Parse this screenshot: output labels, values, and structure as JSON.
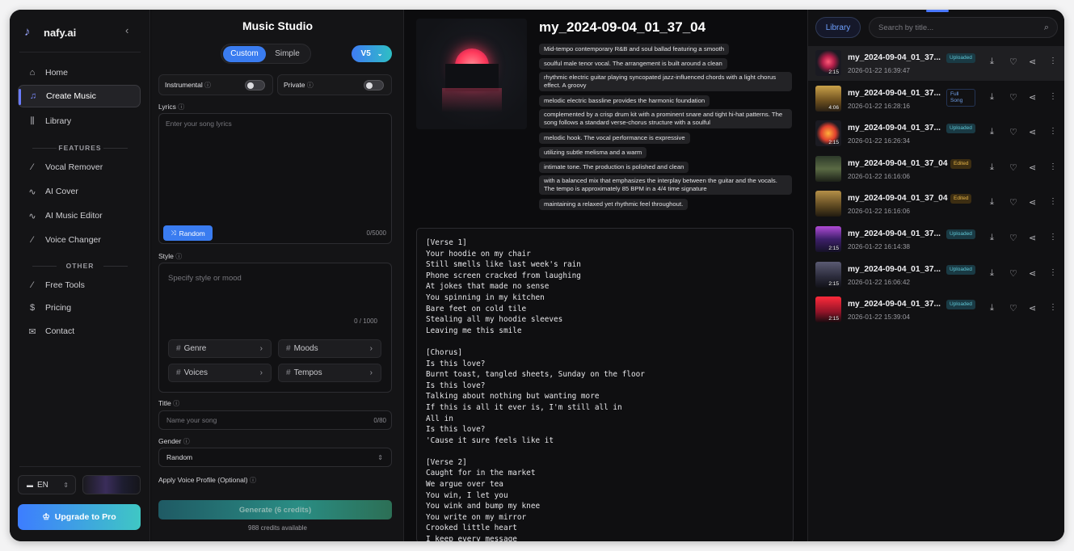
{
  "brand": {
    "name": "nafy.ai"
  },
  "sidebar": {
    "nav": [
      {
        "label": "Home",
        "icon": "home-icon"
      },
      {
        "label": "Create Music",
        "icon": "music-note-icon",
        "active": true
      },
      {
        "label": "Library",
        "icon": "library-icon"
      }
    ],
    "features_heading": "FEATURES",
    "features": [
      {
        "label": "Vocal Remover",
        "icon": "wand-icon"
      },
      {
        "label": "AI Cover",
        "icon": "waveform-icon"
      },
      {
        "label": "AI Music Editor",
        "icon": "waveform-icon"
      },
      {
        "label": "Voice Changer",
        "icon": "wand-icon"
      }
    ],
    "other_heading": "OTHER",
    "other": [
      {
        "label": "Free Tools",
        "icon": "wand-icon"
      },
      {
        "label": "Pricing",
        "icon": "dollar-icon"
      },
      {
        "label": "Contact",
        "icon": "mail-icon"
      }
    ],
    "language": "EN",
    "upgrade_label": "Upgrade to Pro"
  },
  "form": {
    "title": "Music Studio",
    "mode_custom": "Custom",
    "mode_simple": "Simple",
    "version": "V5",
    "instrumental_label": "Instrumental",
    "private_label": "Private",
    "lyrics_label": "Lyrics",
    "lyrics_placeholder": "Enter your song lyrics",
    "lyrics_count": "0/5000",
    "random_label": "Random",
    "style_label": "Style",
    "style_placeholder": "Specify style or mood",
    "style_count": "0 / 1000",
    "chips": {
      "genre": "Genre",
      "moods": "Moods",
      "voices": "Voices",
      "tempos": "Tempos"
    },
    "title_label": "Title",
    "title_placeholder": "Name your song",
    "title_count": "0/80",
    "gender_label": "Gender",
    "gender_value": "Random",
    "voice_profile_label": "Apply Voice Profile (Optional)",
    "generate_label": "Generate (6 credits)",
    "credits_text": "988 credits available"
  },
  "detail": {
    "title": "my_2024-09-04_01_37_04",
    "tags": [
      "Mid-tempo contemporary R&B and soul ballad featuring a smooth",
      "soulful male tenor vocal. The arrangement is built around a clean",
      "rhythmic electric guitar playing syncopated jazz-influenced chords with a light chorus effect. A groovy",
      "melodic electric bassline provides the harmonic foundation",
      "complemented by a crisp drum kit with a prominent snare and tight hi-hat patterns. The song follows a standard verse-chorus structure with a soulful",
      "melodic hook. The vocal performance is expressive",
      "utilizing subtle melisma and a warm",
      "intimate tone. The production is polished and clean",
      "with a balanced mix that emphasizes the interplay between the guitar and the vocals. The tempo is approximately 85 BPM in a 4/4 time signature",
      "maintaining a relaxed yet rhythmic feel throughout."
    ],
    "lyrics": "[Verse 1]\nYour hoodie on my chair\nStill smells like last week's rain\nPhone screen cracked from laughing\nAt jokes that made no sense\nYou spinning in my kitchen\nBare feet on cold tile\nStealing all my hoodie sleeves\nLeaving me this smile\n\n[Chorus]\nIs this love?\nBurnt toast, tangled sheets, Sunday on the floor\nIs this love?\nTalking about nothing but wanting more\nIf this is all it ever is, I'm still all in\nAll in\nIs this love?\n'Cause it sure feels like it\n\n[Verse 2]\nCaught for in the market\nWe argue over tea\nYou win, I let you\nYou wink and bump my knee\nYou write on my mirror\nCrooked little heart\nI keep every message"
  },
  "library": {
    "tab_label": "Library",
    "search_placeholder": "Search by title...",
    "items": [
      {
        "title": "my_2024-09-04_01_37...",
        "date": "2026-01-22 16:39:47",
        "duration": "2:15",
        "badge": "Uploaded"
      },
      {
        "title": "my_2024-09-04_01_37...",
        "date": "2026-01-22 16:28:16",
        "duration": "4:06",
        "badge": "Full Song"
      },
      {
        "title": "my_2024-09-04_01_37...",
        "date": "2026-01-22 16:26:34",
        "duration": "2:15",
        "badge": "Uploaded"
      },
      {
        "title": "my_2024-09-04_01_37_04",
        "date": "2026-01-22 16:16:06",
        "duration": "",
        "badge": "Edited"
      },
      {
        "title": "my_2024-09-04_01_37_04",
        "date": "2026-01-22 16:16:06",
        "duration": "",
        "badge": "Edited"
      },
      {
        "title": "my_2024-09-04_01_37...",
        "date": "2026-01-22 16:14:38",
        "duration": "2:15",
        "badge": "Uploaded"
      },
      {
        "title": "my_2024-09-04_01_37...",
        "date": "2026-01-22 16:06:42",
        "duration": "2:15",
        "badge": "Uploaded"
      },
      {
        "title": "my_2024-09-04_01_37...",
        "date": "2026-01-22 15:39:04",
        "duration": "2:15",
        "badge": "Uploaded"
      }
    ]
  },
  "colors": {
    "accent": "#3a7cf0",
    "teal": "#2ebfc4",
    "uploaded": "#5fc7d6",
    "edited": "#e6b548"
  }
}
